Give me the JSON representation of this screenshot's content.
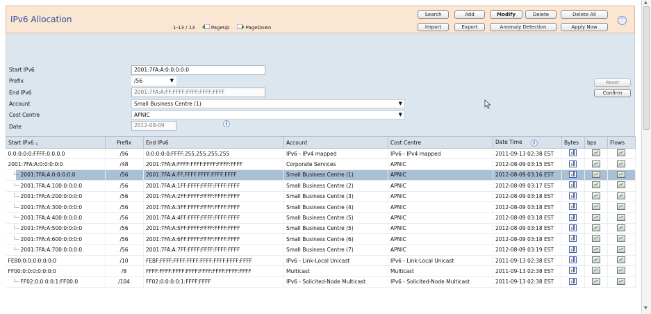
{
  "header": {
    "title": "IPv6 Allocation",
    "range": "1-13 / 13",
    "page_up": "PageUp",
    "page_down": "PageDown"
  },
  "toolbar": {
    "search": "Search",
    "add": "Add",
    "modify": "Modify",
    "delete": "Delete",
    "delete_all": "Delete All",
    "import": "Import",
    "export": "Export",
    "anomaly": "Anomaly Detection",
    "apply_now": "Apply Now"
  },
  "form": {
    "start_label": "Start IPv6",
    "start_value": "2001:7FA:A:0:0:0:0:0",
    "prefix_label": "Prefix",
    "prefix_value": "/56",
    "end_label": "End IPv6",
    "end_value": "2001:7FA:A:FF:FFFF:FFFF:FFFF:FFFF",
    "account_label": "Account",
    "account_value": "Small Business Centre (1)",
    "cost_label": "Cost Centre",
    "cost_value": "APNIC",
    "date_label": "Date",
    "date_value": "2012-08-09",
    "reset": "Reset",
    "confirm": "Confirm"
  },
  "columns": {
    "start": "Start IPv6",
    "prefix": "Prefix",
    "end": "End IPv6",
    "account": "Account",
    "cost": "Cost Centre",
    "datetime": "Date Time",
    "bytes": "Bytes",
    "bps": "bps",
    "flows": "Flows"
  },
  "rows": [
    {
      "start": "0:0:0:0:0:FFFF:0.0.0.0",
      "prefix": "/96",
      "end": "0:0:0:0:0:FFFF:255.255.255.255",
      "account": "IPv6 - IPv4 mapped",
      "cost": "IPv6 - IPv4 mapped",
      "datetime": "2011-09-13 02:38 EST"
    },
    {
      "start": "2001:7FA:A:0:0:0:0:0",
      "prefix": "/48",
      "end": "2001:7FA:A:FFFF:FFFF:FFFF:FFFF:FFFF",
      "account": "Corporate Services",
      "cost": "APNIC",
      "datetime": "2012-08-09 03:15 EST"
    },
    {
      "start": "2001:7FA:A:0:0:0:0:0",
      "prefix": "/56",
      "end": "2001:7FA:A:FF:FFFF:FFFF:FFFF:FFFF",
      "account": "Small Business Centre (1)",
      "cost": "APNIC",
      "datetime": "2012-08-09 03:16 EST"
    },
    {
      "start": "2001:7FA:A:100:0:0:0:0",
      "prefix": "/56",
      "end": "2001:7FA:A:1FF:FFFF:FFFF:FFFF:FFFF",
      "account": "Small Business Centre (2)",
      "cost": "APNIC",
      "datetime": "2012-08-09 03:17 EST"
    },
    {
      "start": "2001:7FA:A:200:0:0:0:0",
      "prefix": "/56",
      "end": "2001:7FA:A:2FF:FFFF:FFFF:FFFF:FFFF",
      "account": "Small Business Centre (3)",
      "cost": "APNIC",
      "datetime": "2012-08-09 03:18 EST"
    },
    {
      "start": "2001:7FA:A:300:0:0:0:0",
      "prefix": "/56",
      "end": "2001:7FA:A:3FF:FFFF:FFFF:FFFF:FFFF",
      "account": "Small Business Centre (4)",
      "cost": "APNIC",
      "datetime": "2012-08-09 03:18 EST"
    },
    {
      "start": "2001:7FA:A:400:0:0:0:0",
      "prefix": "/56",
      "end": "2001:7FA:A:4FF:FFFF:FFFF:FFFF:FFFF",
      "account": "Small Business Centre (5)",
      "cost": "APNIC",
      "datetime": "2012-08-09 03:18 EST"
    },
    {
      "start": "2001:7FA:A:500:0:0:0:0",
      "prefix": "/56",
      "end": "2001:7FA:A:5FF:FFFF:FFFF:FFFF:FFFF",
      "account": "Small Business Centre (5)",
      "cost": "APNIC",
      "datetime": "2012-08-09 03:18 EST"
    },
    {
      "start": "2001:7FA:A:600:0:0:0:0",
      "prefix": "/56",
      "end": "2001:7FA:A:6FF:FFFF:FFFF:FFFF:FFFF",
      "account": "Small Business Centre (6)",
      "cost": "APNIC",
      "datetime": "2012-08-09 03:18 EST"
    },
    {
      "start": "2001:7FA:A:700:0:0:0:0",
      "prefix": "/56",
      "end": "2001:7FA:A:7FF:FFFF:FFFF:FFFF:FFFF",
      "account": "Small Business Centre (7)",
      "cost": "APNIC",
      "datetime": "2012-08-09 03:19 EST"
    },
    {
      "start": "FE80:0:0:0:0:0:0:0",
      "prefix": "/10",
      "end": "FEBF:FFFF:FFFF:FFFF:FFFF:FFFF:FFFF:FFFF",
      "account": "IPv6 - Link-Local Unicast",
      "cost": "IPv6 - Link-Local Unicast",
      "datetime": "2011-09-13 02:38 EST"
    },
    {
      "start": "FF00:0:0:0:0:0:0:0",
      "prefix": "/8",
      "end": "FFFF:FFFF:FFFF:FFFF:FFFF:FFFF:FFFF:FFFF",
      "account": "Multicast",
      "cost": "Multicast",
      "datetime": "2011-09-13 02:38 EST"
    },
    {
      "start": "FF02:0:0:0:0:1:FF00:0",
      "prefix": "/104",
      "end": "FF02:0:0:0:0:1:FFFF:FFFF",
      "account": "IPv6 - Solicited-Node Multicast",
      "cost": "IPv6 - Solicited-Node Multicast",
      "datetime": "2011-09-13 02:38 EST"
    }
  ]
}
